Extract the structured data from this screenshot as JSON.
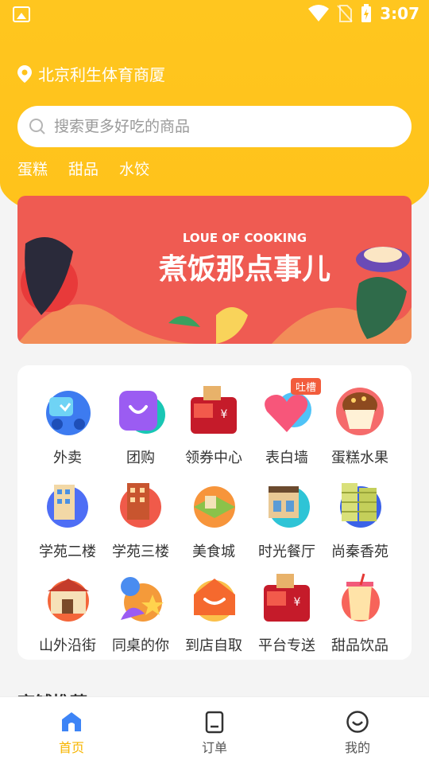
{
  "status_bar": {
    "time": "3:07"
  },
  "location": {
    "text": "北京利生体育商厦"
  },
  "search": {
    "placeholder": "搜索更多好吃的商品"
  },
  "hot_tags": [
    "蛋糕",
    "甜品",
    "水饺"
  ],
  "banner": {
    "english": "LOUE OF COOKING",
    "chinese": "煮饭那点事儿"
  },
  "categories": [
    {
      "label": "外卖",
      "icon": "scooter-icon"
    },
    {
      "label": "团购",
      "icon": "shopping-bag-icon"
    },
    {
      "label": "领券中心",
      "icon": "coupon-box-icon"
    },
    {
      "label": "表白墙",
      "icon": "heart-icon",
      "badge": "吐槽"
    },
    {
      "label": "蛋糕水果",
      "icon": "cake-icon"
    },
    {
      "label": "学苑二楼",
      "icon": "building-icon"
    },
    {
      "label": "学苑三楼",
      "icon": "building-icon"
    },
    {
      "label": "美食城",
      "icon": "food-court-icon"
    },
    {
      "label": "时光餐厅",
      "icon": "restaurant-icon"
    },
    {
      "label": "尚秦香苑",
      "icon": "apartment-icon"
    },
    {
      "label": "山外沿街",
      "icon": "storefront-icon"
    },
    {
      "label": "同桌的你",
      "icon": "friends-icon"
    },
    {
      "label": "到店自取",
      "icon": "pickup-icon"
    },
    {
      "label": "平台专送",
      "icon": "delivery-box-icon"
    },
    {
      "label": "甜品饮品",
      "icon": "drink-cup-icon"
    }
  ],
  "section_peek": "商铺推荐",
  "tabs": [
    {
      "label": "首页",
      "icon": "home-icon",
      "active": true
    },
    {
      "label": "订单",
      "icon": "order-icon",
      "active": false
    },
    {
      "label": "我的",
      "icon": "profile-icon",
      "active": false
    }
  ],
  "colors": {
    "primary": "#ffc21a",
    "accent_text": "#f7b500",
    "banner_red": "#ef5b52",
    "badge": "#f25c3c"
  }
}
